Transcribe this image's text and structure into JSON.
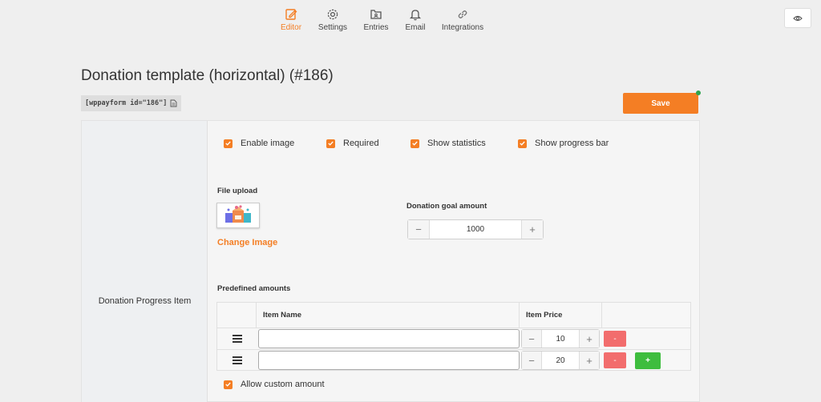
{
  "nav": {
    "items": [
      {
        "label": "Editor",
        "icon": "edit-icon",
        "active": true
      },
      {
        "label": "Settings",
        "icon": "gear-icon",
        "active": false
      },
      {
        "label": "Entries",
        "icon": "entries-icon",
        "active": false
      },
      {
        "label": "Email",
        "icon": "bell-icon",
        "active": false
      },
      {
        "label": "Integrations",
        "icon": "link-icon",
        "active": false
      }
    ]
  },
  "preview_icon": "eye-icon",
  "page": {
    "title": "Donation template (horizontal) (#186)",
    "shortcode": "[wppayform id=\"186\"]",
    "save_label": "Save"
  },
  "field": {
    "label": "Donation Progress Item",
    "options": [
      {
        "label": "Enable image",
        "checked": true
      },
      {
        "label": "Required",
        "checked": true
      },
      {
        "label": "Show statistics",
        "checked": true
      },
      {
        "label": "Show progress bar",
        "checked": true
      }
    ],
    "file_upload_label": "File upload",
    "change_image_label": "Change Image",
    "goal_label": "Donation goal amount",
    "goal_value": "1000",
    "predefined_label": "Predefined amounts",
    "table": {
      "headers": [
        "Item Name",
        "Item Price"
      ],
      "rows": [
        {
          "name": "",
          "price": "10"
        },
        {
          "name": "",
          "price": "20"
        }
      ],
      "remove_label": "-",
      "add_label": "+"
    },
    "allow_custom_label": "Allow custom amount"
  },
  "colors": {
    "accent": "#f47e24",
    "danger": "#f26d6d",
    "success": "#3ebd3e"
  }
}
